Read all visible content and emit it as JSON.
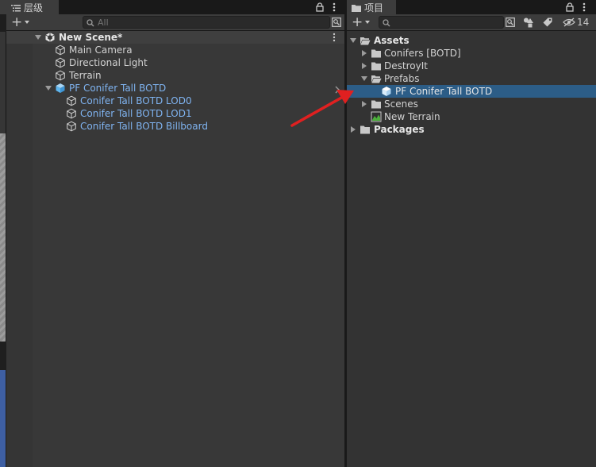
{
  "hierarchy": {
    "tab_label": "层级",
    "add_label": "+",
    "search_placeholder": "All",
    "items": [
      {
        "label": "New Scene*"
      },
      {
        "label": "Main Camera"
      },
      {
        "label": "Directional Light"
      },
      {
        "label": "Terrain"
      },
      {
        "label": "PF Conifer Tall BOTD"
      },
      {
        "label": "Conifer Tall BOTD LOD0"
      },
      {
        "label": "Conifer Tall BOTD LOD1"
      },
      {
        "label": "Conifer Tall BOTD Billboard"
      }
    ]
  },
  "project": {
    "tab_label": "项目",
    "add_label": "+",
    "hidden_count": "14",
    "items": [
      {
        "label": "Assets"
      },
      {
        "label": "Conifers [BOTD]"
      },
      {
        "label": "DestroyIt"
      },
      {
        "label": "Prefabs"
      },
      {
        "label": "PF Conifer Tall BOTD"
      },
      {
        "label": "Scenes"
      },
      {
        "label": "New Terrain"
      },
      {
        "label": "Packages"
      }
    ]
  },
  "colors": {
    "accent_selection": "#2c5d87",
    "prefab_text": "#7fb3f0",
    "annotation_arrow": "#e02020"
  }
}
